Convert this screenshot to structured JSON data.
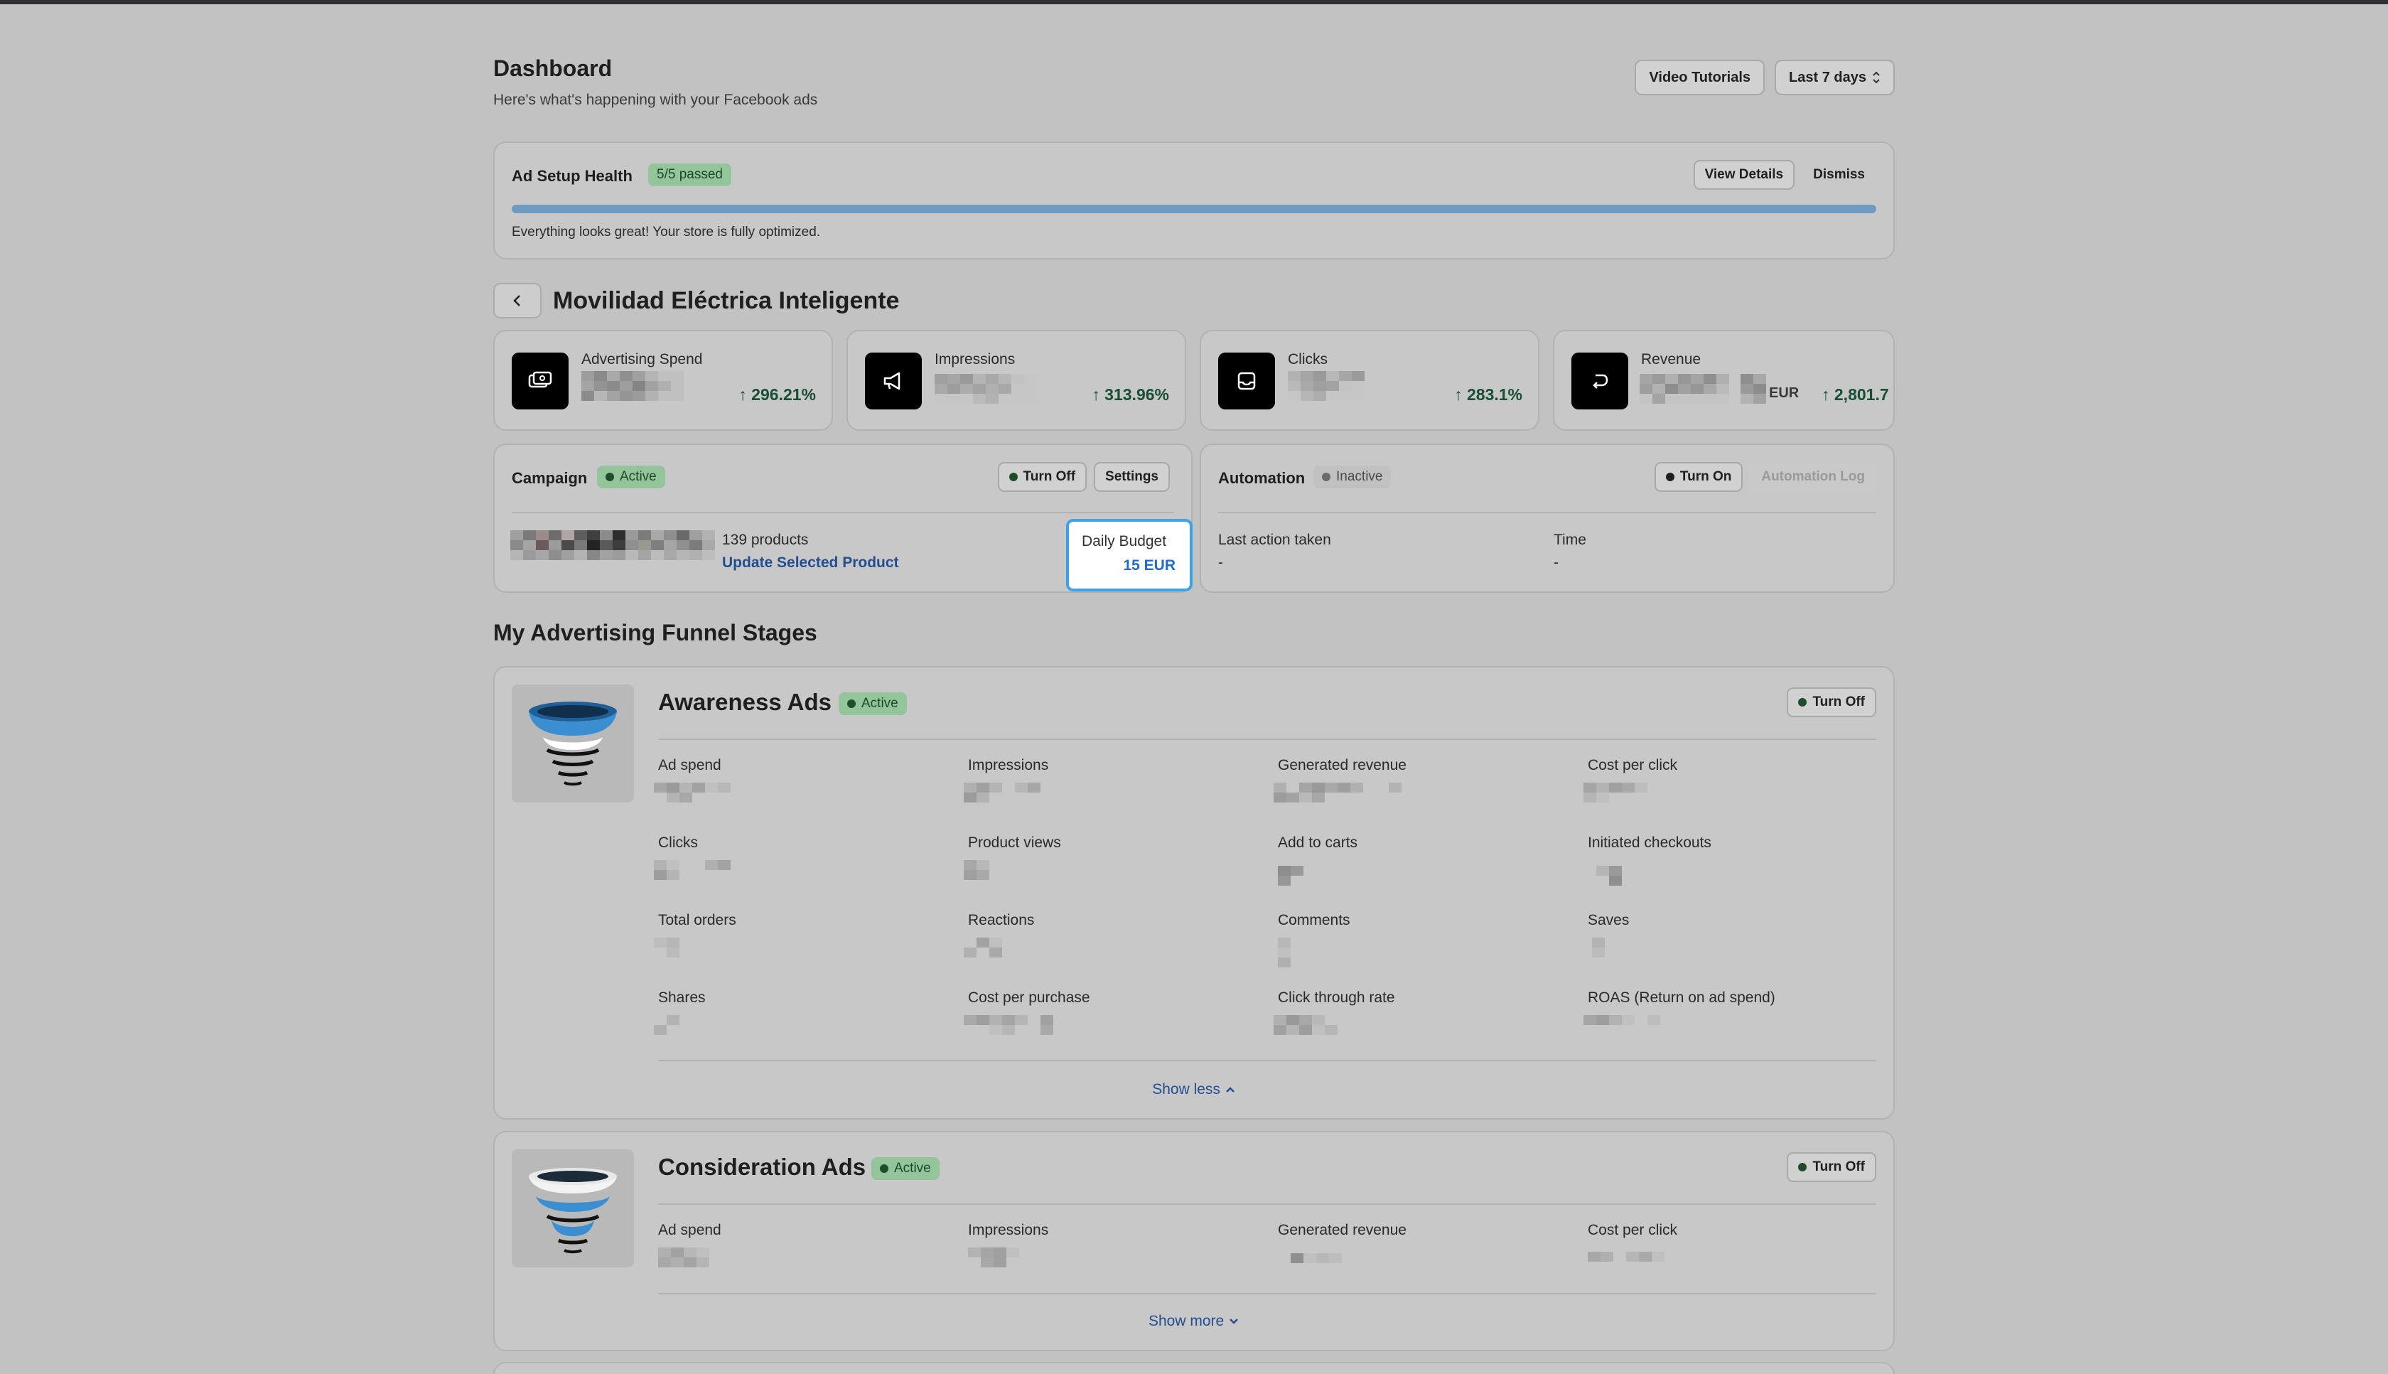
{
  "header": {
    "title": "Dashboard",
    "subtitle": "Here's what's happening with your Facebook ads",
    "video_tutorials": "Video Tutorials",
    "date_range": "Last 7 days"
  },
  "health": {
    "title": "Ad Setup Health",
    "badge": "5/5 passed",
    "view_details": "View Details",
    "dismiss": "Dismiss",
    "progress": 1.0,
    "message": "Everything looks great! Your store is fully optimized."
  },
  "store": {
    "name": "Movilidad Eléctrica Inteligente"
  },
  "metrics": [
    {
      "label": "Advertising Spend",
      "change": "↑ 296.21%",
      "icon": "money-icon"
    },
    {
      "label": "Impressions",
      "change": "↑ 313.96%",
      "icon": "megaphone-icon"
    },
    {
      "label": "Clicks",
      "change": "↑ 283.1%",
      "icon": "inbox-icon"
    },
    {
      "label": "Revenue",
      "currency": "EUR",
      "change": "↑ 2,801.7",
      "icon": "return-icon"
    }
  ],
  "campaign": {
    "title": "Campaign",
    "status": "Active",
    "turn_off": "Turn Off",
    "settings": "Settings",
    "products": "139 products",
    "update_link": "Update Selected Product",
    "daily_budget_label": "Daily Budget",
    "daily_budget_value": "15 EUR"
  },
  "automation": {
    "title": "Automation",
    "status": "Inactive",
    "turn_on": "Turn On",
    "log": "Automation Log",
    "last_action_label": "Last action taken",
    "last_action_value": "-",
    "time_label": "Time",
    "time_value": "-"
  },
  "funnel": {
    "title": "My Advertising Funnel Stages",
    "stages": [
      {
        "name": "Awareness Ads",
        "status": "Active",
        "turn_off": "Turn Off",
        "stats": [
          "Ad spend",
          "Impressions",
          "Generated revenue",
          "Cost per click",
          "Clicks",
          "Product views",
          "Add to carts",
          "Initiated checkouts",
          "Total orders",
          "Reactions",
          "Comments",
          "Saves",
          "Shares",
          "Cost per purchase",
          "Click through rate",
          "ROAS (Return on ad spend)"
        ],
        "toggle": "Show less"
      },
      {
        "name": "Consideration Ads",
        "status": "Active",
        "turn_off": "Turn Off",
        "stats": [
          "Ad spend",
          "Impressions",
          "Generated revenue",
          "Cost per click"
        ],
        "toggle": "Show more"
      }
    ]
  },
  "colors": {
    "background": "#c2c2c2",
    "accent_link": "#234e8f",
    "active_badge": "#93c49a",
    "budget_highlight": "#3da2e8",
    "positive_change": "#1a4f36"
  }
}
